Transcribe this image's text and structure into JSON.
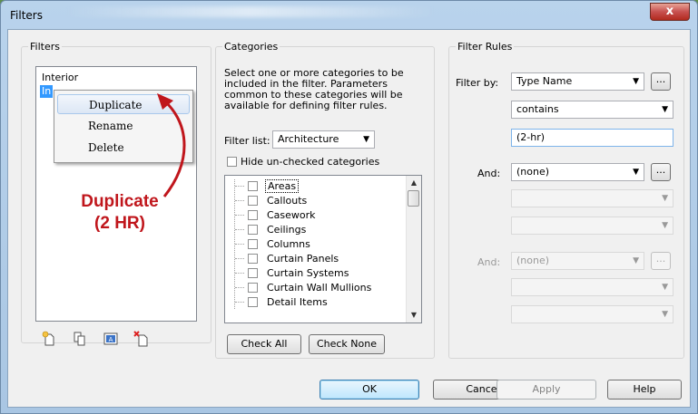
{
  "window": {
    "title": "Filters",
    "close_glyph": "x"
  },
  "filters_panel": {
    "label": "Filters",
    "items": [
      {
        "label": "Interior",
        "selected": false
      },
      {
        "label": "In",
        "selected": true
      }
    ],
    "context_menu": [
      {
        "label": "Duplicate",
        "hovered": true
      },
      {
        "label": "Rename",
        "hovered": false
      },
      {
        "label": "Delete",
        "hovered": false
      }
    ],
    "annotation": {
      "line1": "Duplicate",
      "line2": "(2 HR)",
      "color": "#c0161c"
    },
    "toolbar_icons": [
      "new-filter-icon",
      "duplicate-filter-icon",
      "rename-filter-icon",
      "delete-filter-icon"
    ]
  },
  "categories_panel": {
    "label": "Categories",
    "description": "Select one or more categories to be included in the filter.  Parameters common to these categories will be available for defining filter rules.",
    "filter_list_label": "Filter list:",
    "filter_list_value": "Architecture",
    "hide_unchecked_label": "Hide un-checked categories",
    "hide_unchecked_checked": false,
    "categories": [
      "Areas",
      "Callouts",
      "Casework",
      "Ceilings",
      "Columns",
      "Curtain Panels",
      "Curtain Systems",
      "Curtain Wall Mullions",
      "Detail Items"
    ],
    "focused_category": "Areas",
    "check_all_label": "Check All",
    "check_none_label": "Check None"
  },
  "rules_panel": {
    "label": "Filter Rules",
    "filter_by_label": "Filter by:",
    "filter_by_value": "Type Name",
    "operator_value": "contains",
    "rule_value": "(2-hr)",
    "and1_label": "And:",
    "and1_value": "(none)",
    "and2_label": "And:",
    "and2_value": "(none)",
    "ellipsis_label": "..."
  },
  "footer": {
    "ok_label": "OK",
    "cancel_label": "Cancel",
    "apply_label": "Apply",
    "help_label": "Help"
  },
  "colors": {
    "selection": "#3399ff",
    "accent_arrow": "#c0161c"
  }
}
